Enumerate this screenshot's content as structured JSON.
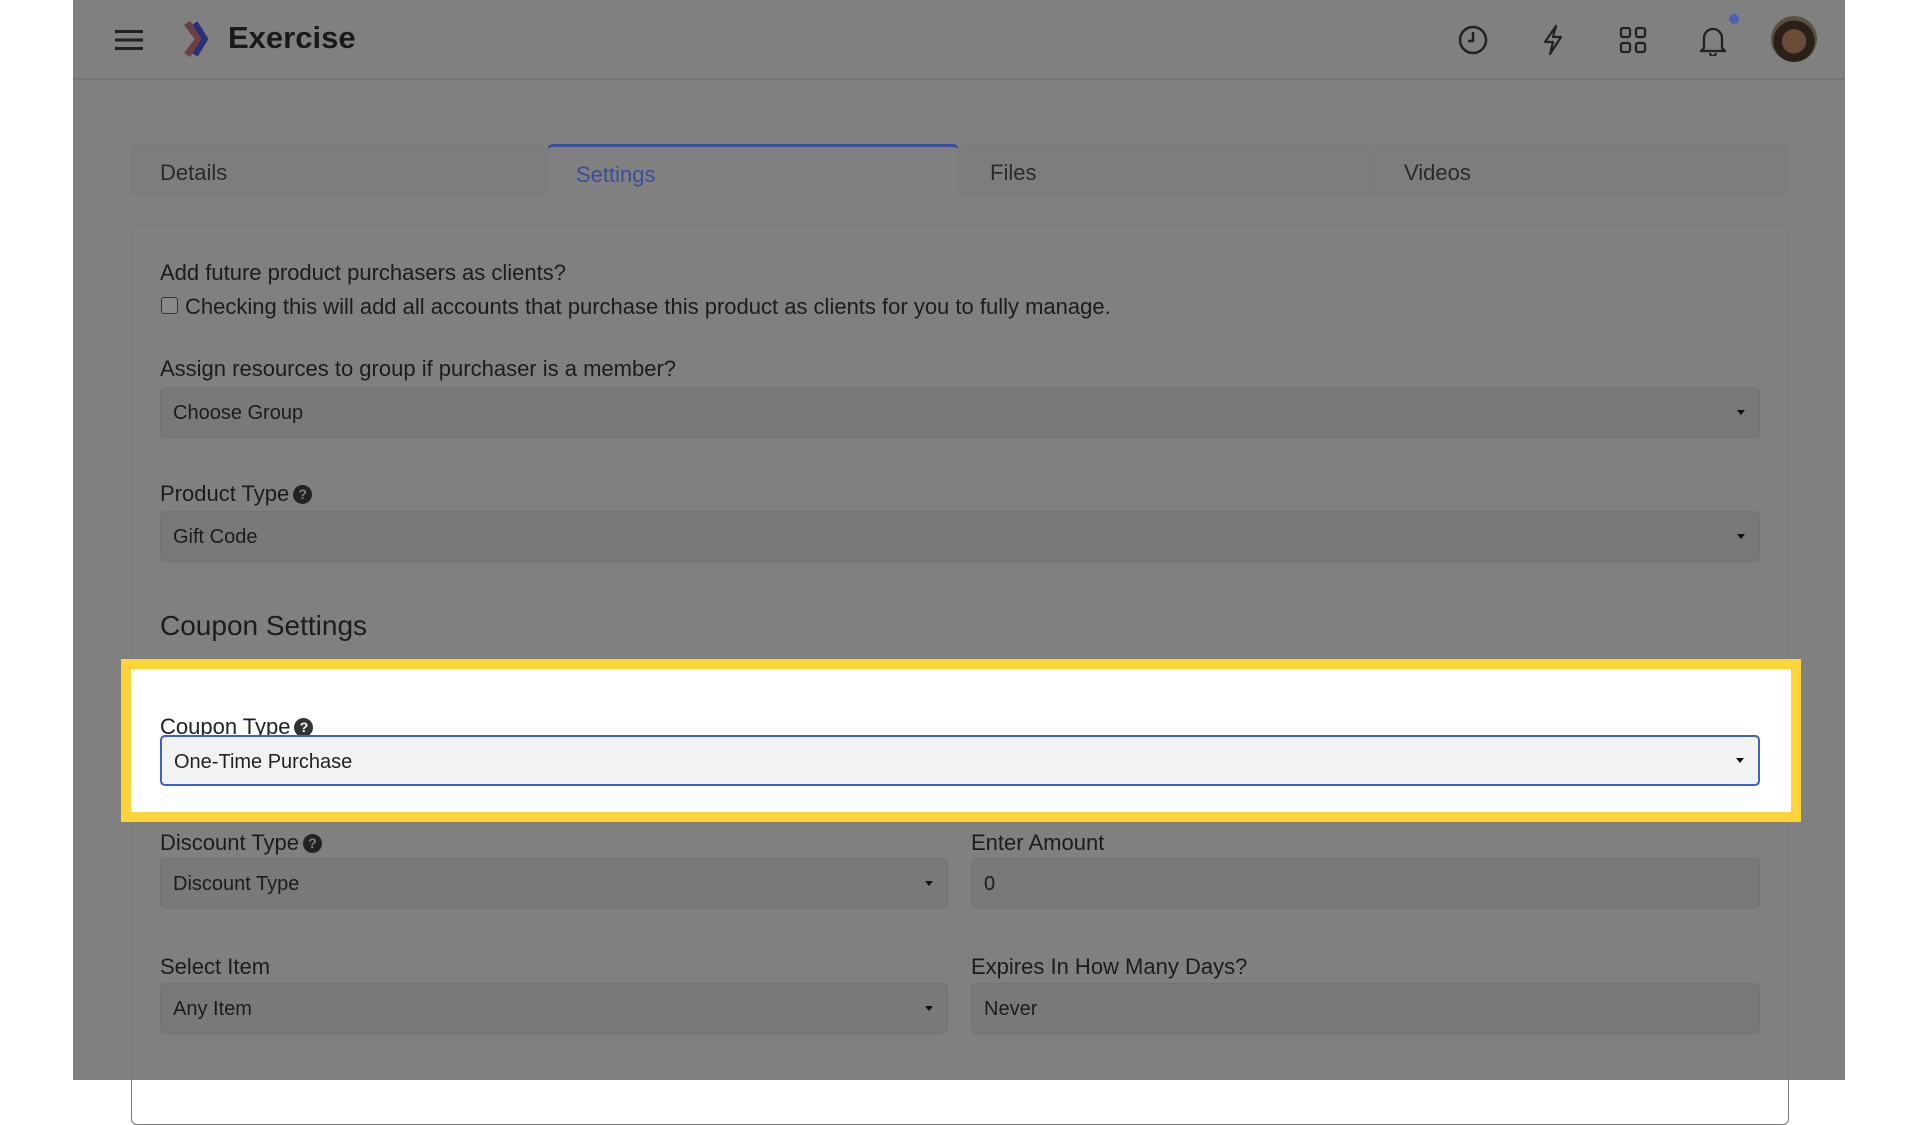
{
  "header": {
    "app_name": "Exercise",
    "icons": [
      "menu-icon",
      "clock-icon",
      "lightning-icon",
      "grid-icon",
      "bell-icon",
      "avatar"
    ],
    "notification_dot_color": "#4a6fd6"
  },
  "tabs": [
    {
      "label": "Details"
    },
    {
      "label": "Settings",
      "active": true
    },
    {
      "label": "Files"
    },
    {
      "label": "Videos"
    }
  ],
  "settings": {
    "clients_question": "Add future product purchasers as clients?",
    "clients_checkbox_label": "Checking this will add all accounts that purchase this product as clients for you to fully manage.",
    "clients_checked": false,
    "group_label": "Assign resources to group if purchaser is a member?",
    "group_value": "Choose Group",
    "product_type_label": "Product Type",
    "product_type_value": "Gift Code",
    "coupon_heading": "Coupon Settings",
    "coupon_type_label": "Coupon Type",
    "coupon_type_value": "One-Time Purchase",
    "discount_type_label": "Discount Type",
    "discount_type_value": "Discount Type",
    "amount_label": "Enter Amount",
    "amount_value": "0",
    "select_item_label": "Select Item",
    "select_item_value": "Any Item",
    "expires_label": "Expires In How Many Days?",
    "expires_value": "Never"
  },
  "colors": {
    "highlight": "#ffd43b",
    "accent": "#3a62c9"
  }
}
